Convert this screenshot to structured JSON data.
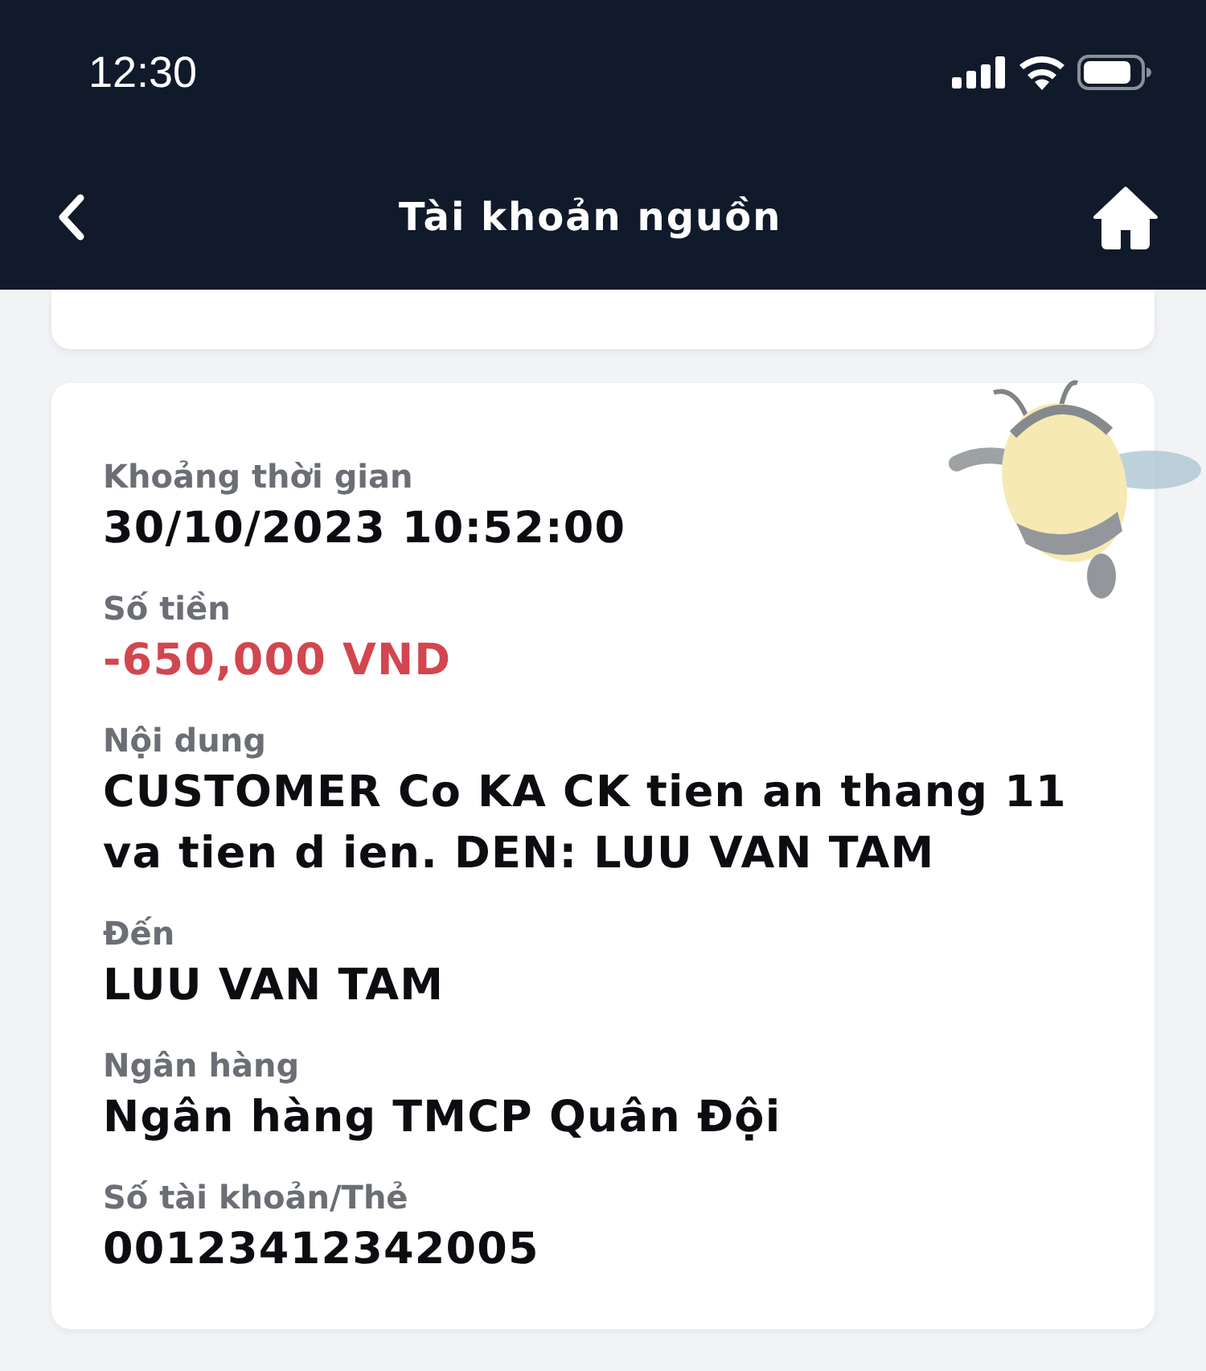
{
  "status_bar": {
    "time": "12:30"
  },
  "header": {
    "title": "Tài khoản nguồn"
  },
  "details": [
    {
      "label": "Khoảng thời gian",
      "value": "30/10/2023 10:52:00",
      "kind": "text"
    },
    {
      "label": "Số tiền",
      "value": "-650,000 VND",
      "kind": "amount"
    },
    {
      "label": "Nội dung",
      "value": "CUSTOMER Co KA CK tien an thang 11 va tien d ien. DEN: LUU VAN TAM",
      "kind": "text"
    },
    {
      "label": "Đến",
      "value": "LUU VAN TAM",
      "kind": "text"
    },
    {
      "label": "Ngân hàng",
      "value": "Ngân hàng TMCP Quân Đội",
      "kind": "text"
    },
    {
      "label": "Số tài khoản/Thẻ",
      "value": "00123412342005",
      "kind": "text"
    }
  ]
}
